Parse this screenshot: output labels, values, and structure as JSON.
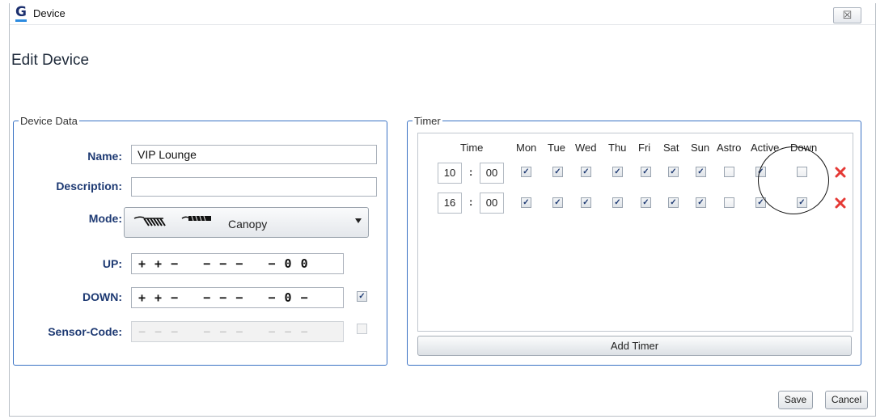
{
  "window": {
    "title": "Device",
    "close_glyph": "☒"
  },
  "page_title": "Edit Device",
  "device_data": {
    "legend": "Device Data",
    "name_label": "Name:",
    "name_value": "VIP Lounge",
    "description_label": "Description:",
    "description_value": "",
    "mode_label": "Mode:",
    "mode_value": "Canopy",
    "up_label": "UP:",
    "up_code": "+ + −   − − −   − 0 0",
    "down_label": "DOWN:",
    "down_code": "+ + −   − − −   − 0 −",
    "down_checked": true,
    "sensor_label": "Sensor-Code:",
    "sensor_code": "− − −   − − −   − − −",
    "sensor_checked": false
  },
  "timer": {
    "legend": "Timer",
    "headers": [
      "Time",
      "Mon",
      "Tue",
      "Wed",
      "Thu",
      "Fri",
      "Sat",
      "Sun",
      "Astro",
      "Active",
      "Down"
    ],
    "rows": [
      {
        "hour": "10",
        "minute": "00",
        "mon": true,
        "tue": true,
        "wed": true,
        "thu": true,
        "fri": true,
        "sat": true,
        "sun": true,
        "astro": false,
        "active": true,
        "down": false
      },
      {
        "hour": "16",
        "minute": "00",
        "mon": true,
        "tue": true,
        "wed": true,
        "thu": true,
        "fri": true,
        "sat": true,
        "sun": true,
        "astro": false,
        "active": true,
        "down": true
      }
    ],
    "add_label": "Add Timer",
    "delete_icon": "delete-x-icon",
    "delete_color": "#e53935"
  },
  "footer": {
    "save_label": "Save",
    "cancel_label": "Cancel"
  },
  "colors": {
    "accent": "#3a72c4",
    "label": "#1e3a73"
  }
}
